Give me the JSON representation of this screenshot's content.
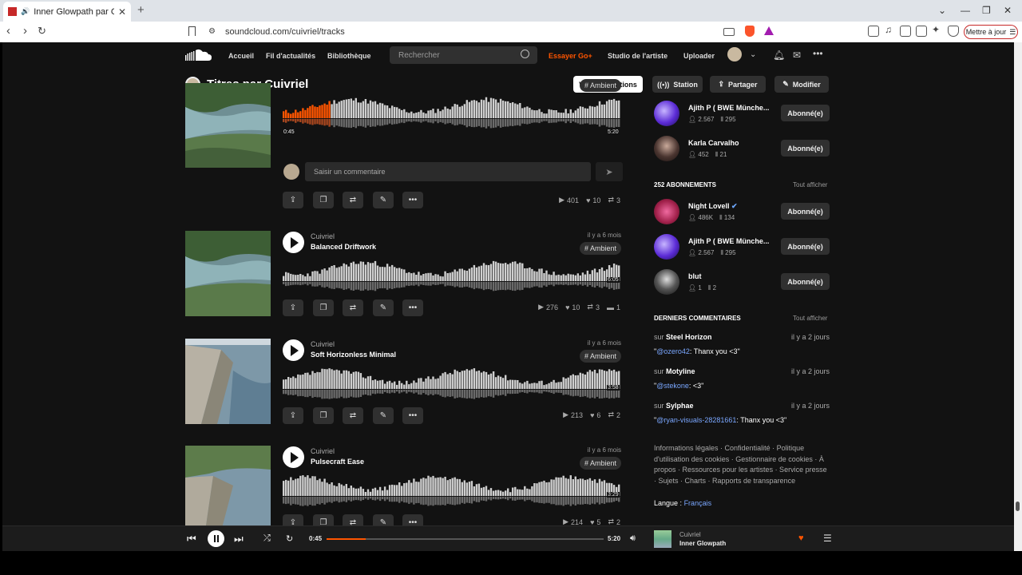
{
  "browser": {
    "tab_title": "Inner Glowpath par Cuivriel",
    "url": "soundcloud.com/cuivriel/tracks",
    "update_label": "Mettre à jour"
  },
  "nav": {
    "home": "Accueil",
    "feed": "Fil d'actualités",
    "library": "Bibliothèque",
    "search_placeholder": "Rechercher",
    "try_go": "Essayer Go+",
    "studio": "Studio de l'artiste",
    "upload": "Uploader"
  },
  "page": {
    "title": "Titres par Cuivriel",
    "btn_info": "Vos informations",
    "btn_station": "Station",
    "btn_share": "Partager",
    "btn_edit": "Modifier"
  },
  "tracks": [
    {
      "user": "",
      "title": "",
      "date": "",
      "tag": "# Ambient",
      "elapsed": "0:45",
      "duration": "5:20",
      "plays": "401",
      "likes": "10",
      "reposts": "3",
      "comments": "",
      "progress": 0.14
    },
    {
      "user": "Cuivriel",
      "title": "Balanced Driftwork",
      "date": "il y a 6 mois",
      "tag": "# Ambient",
      "duration": "6:05",
      "plays": "276",
      "likes": "10",
      "reposts": "3",
      "comments": "1"
    },
    {
      "user": "Cuivriel",
      "title": "Soft Horizonless Minimal",
      "date": "il y a 6 mois",
      "tag": "# Ambient",
      "duration": "3:58",
      "plays": "213",
      "likes": "6",
      "reposts": "2"
    },
    {
      "user": "Cuivriel",
      "title": "Pulsecraft Ease",
      "date": "il y a 6 mois",
      "tag": "# Ambient",
      "duration": "3:29",
      "plays": "214",
      "likes": "5",
      "reposts": "2"
    }
  ],
  "comment_input": {
    "placeholder": "Saisir un commentaire"
  },
  "sidebar": {
    "top_users": [
      {
        "name": "Ajith P ( BWE Münche...",
        "followers": "2.567",
        "tracks": "295",
        "button": "Abonné(e)"
      },
      {
        "name": "Karla Carvalho",
        "followers": "452",
        "tracks": "21",
        "button": "Abonné(e)"
      }
    ],
    "following_title": "252 ABONNEMENTS",
    "see_all": "Tout afficher",
    "following": [
      {
        "name": "Night Lovell",
        "followers": "486K",
        "tracks": "134",
        "button": "Abonné(e)"
      },
      {
        "name": "Ajith P ( BWE Münche...",
        "followers": "2.567",
        "tracks": "295",
        "button": "Abonné(e)"
      },
      {
        "name": "blut",
        "followers": "1",
        "tracks": "2",
        "button": "Abonné(e)"
      }
    ],
    "comments_title": "DERNIERS COMMENTAIRES",
    "comments": [
      {
        "on": "sur",
        "track": "Steel Horizon",
        "date": "il y a 2 jours",
        "quote_open": "\"",
        "mention": "@ozero42",
        "text": ": Thanx you <3\""
      },
      {
        "on": "sur",
        "track": "Motyline",
        "date": "il y a 2 jours",
        "quote_open": "\"",
        "mention": "@stekone",
        "text": ": <3\""
      },
      {
        "on": "sur",
        "track": "Sylphae",
        "date": "il y a 2 jours",
        "quote_open": "\"",
        "mention": "@ryan-visuals-28281661",
        "text": ": Thanx you <3\""
      }
    ],
    "legal": "Informations légales · Confidentialité · Politique d'utilisation des cookies · Gestionnaire de cookies · À propos · Ressources pour les artistes · Service presse · Sujets · Charts · Rapports de transparence",
    "lang_label": "Langue :",
    "lang_value": "Français"
  },
  "player": {
    "elapsed": "0:45",
    "duration": "5:20",
    "progress": 0.14,
    "user": "Cuivriel",
    "title": "Inner Glowpath"
  },
  "colors": {
    "accent": "#ff5500",
    "bg": "#121212",
    "link": "#7aa7ff"
  }
}
